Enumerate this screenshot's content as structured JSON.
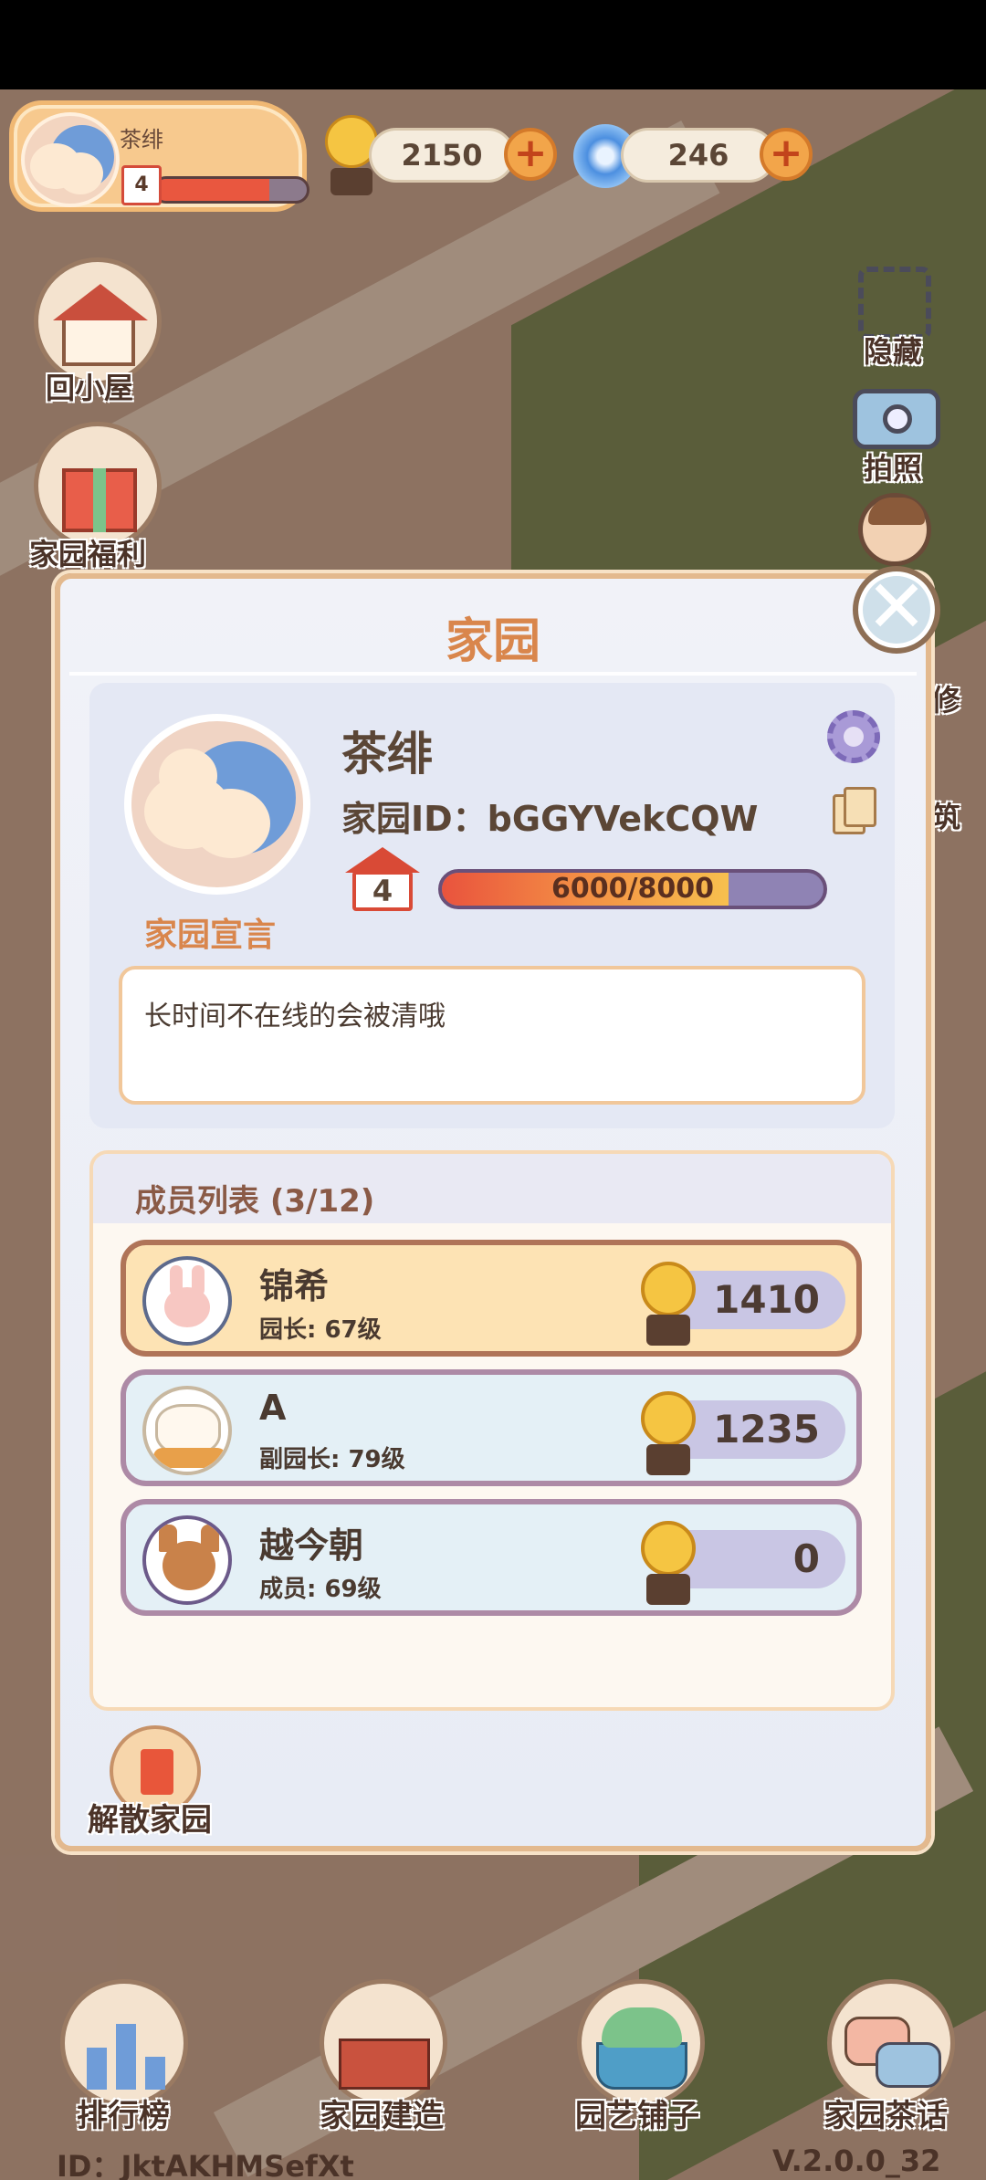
{
  "top_bar": {
    "player_name": "茶绯",
    "player_level": "4",
    "snail_coins": "2150",
    "swirl_gems": "246",
    "plus_symbol": "+"
  },
  "side_left": {
    "home_label": "回小屋",
    "welfare_label": "家园福利"
  },
  "side_right": {
    "hide_label": "隐藏",
    "photo_label": "拍照",
    "repair_label": "修",
    "build_label": "筑"
  },
  "modal": {
    "title": "家园",
    "close_symbol": "✕",
    "user_name": "茶绯",
    "home_id": "家园ID：bGGYVekCQW",
    "level": "4",
    "exp_text": "6000/8000",
    "exp_fraction": 0.75,
    "declaration_label": "家园宣言",
    "declaration_text": "长时间不在线的会被清哦",
    "members_title": "成员列表 (3/12)",
    "members": [
      {
        "name": "锦希",
        "role": "园长: 67级",
        "score": "1410"
      },
      {
        "name": "A",
        "role": "副园长: 79级",
        "score": "1235"
      },
      {
        "name": "越今朝",
        "role": "成员: 69级",
        "score": "0"
      }
    ],
    "dissolve_label": "解散家园"
  },
  "bottom_nav": {
    "rank_label": "排行榜",
    "build_label": "家园建造",
    "shop_label": "园艺铺子",
    "chat_label": "家园茶话"
  },
  "footer": {
    "id_text": "ID：JktAKHMSefXt",
    "version": "V.2.0.0_32"
  },
  "colors": {
    "accent_orange": "#d9864c",
    "exp_fill": "#e9533d",
    "leader_row": "#fde3b4",
    "member_row": "#e4f0f6"
  }
}
